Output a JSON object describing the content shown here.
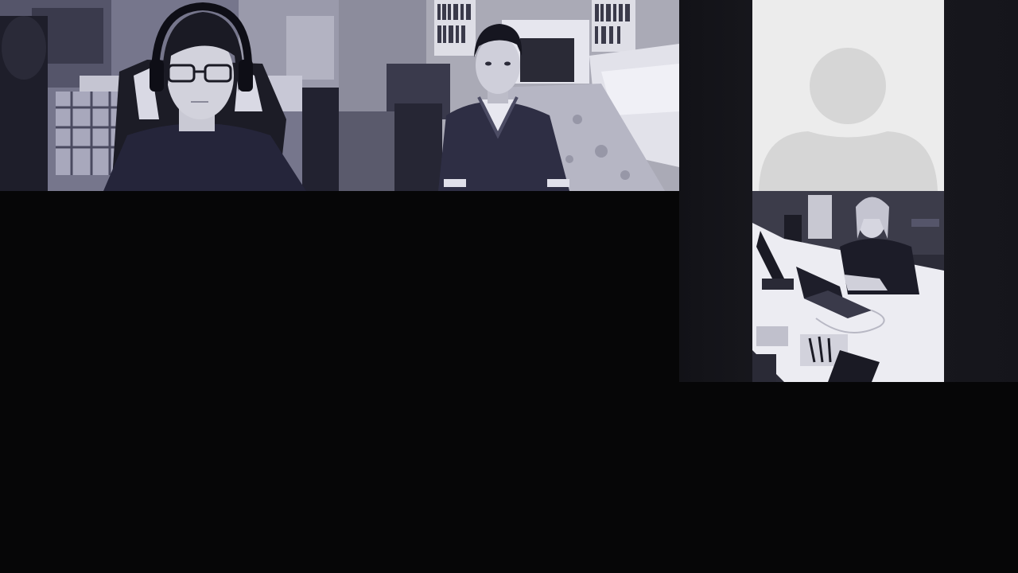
{
  "meeting": {
    "participants": [
      {
        "tile": "video-tile-1",
        "video": "on"
      },
      {
        "tile": "video-tile-2",
        "video": "on"
      },
      {
        "tile": "video-tile-3",
        "video": "off",
        "placeholder_icon": "avatar-placeholder-icon"
      },
      {
        "tile": "video-tile-4",
        "video": "on"
      }
    ]
  },
  "colors": {
    "background": "#060607",
    "side_panel": "#16161c",
    "placeholder_bg": "#ececec",
    "placeholder_silhouette": "#d6d6d6",
    "video_tint": "#5e5e78"
  }
}
